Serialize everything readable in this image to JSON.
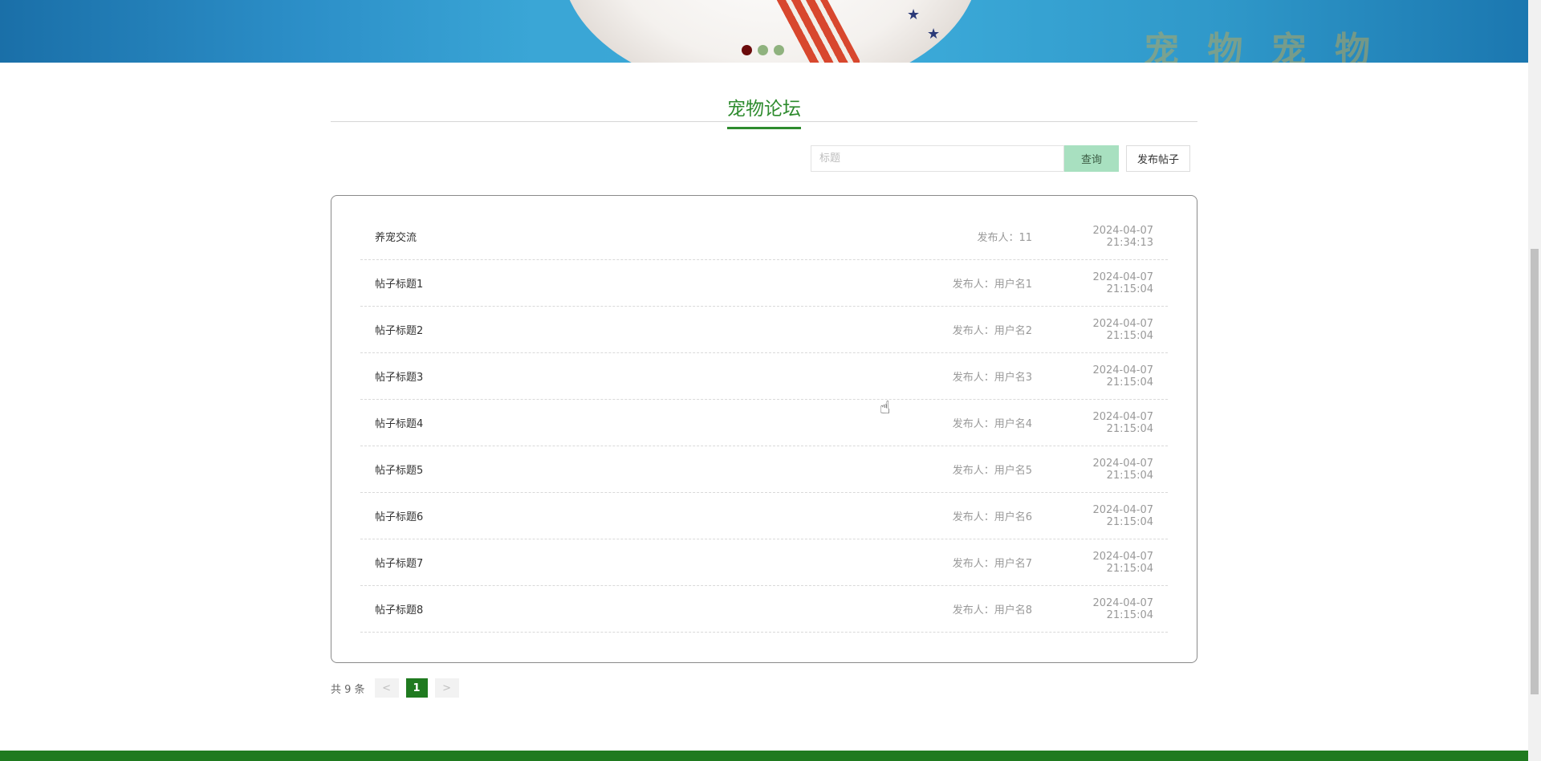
{
  "banner": {
    "brand_text": "宠 物 宠 物",
    "carousel_dots": [
      "slide-1",
      "slide-2",
      "slide-3"
    ],
    "active_dot": 0
  },
  "section": {
    "title": "宠物论坛"
  },
  "search": {
    "placeholder": "标题",
    "query_label": "查询",
    "post_label": "发布帖子"
  },
  "posts": [
    {
      "title": "养宠交流",
      "author": "发布人：11",
      "time": "2024-04-07 21:34:13"
    },
    {
      "title": "帖子标题1",
      "author": "发布人：用户名1",
      "time": "2024-04-07 21:15:04"
    },
    {
      "title": "帖子标题2",
      "author": "发布人：用户名2",
      "time": "2024-04-07 21:15:04"
    },
    {
      "title": "帖子标题3",
      "author": "发布人：用户名3",
      "time": "2024-04-07 21:15:04"
    },
    {
      "title": "帖子标题4",
      "author": "发布人：用户名4",
      "time": "2024-04-07 21:15:04"
    },
    {
      "title": "帖子标题5",
      "author": "发布人：用户名5",
      "time": "2024-04-07 21:15:04"
    },
    {
      "title": "帖子标题6",
      "author": "发布人：用户名6",
      "time": "2024-04-07 21:15:04"
    },
    {
      "title": "帖子标题7",
      "author": "发布人：用户名7",
      "time": "2024-04-07 21:15:04"
    },
    {
      "title": "帖子标题8",
      "author": "发布人：用户名8",
      "time": "2024-04-07 21:15:04"
    }
  ],
  "pagination": {
    "total_text": "共 9 条",
    "prev_label": "<",
    "current_page": "1",
    "next_label": ">"
  },
  "colors": {
    "accent": "#2e8b2e",
    "footer": "#1f7a1f",
    "query_button": "#a8e0c0",
    "active_dot": "#6b0b0b"
  }
}
